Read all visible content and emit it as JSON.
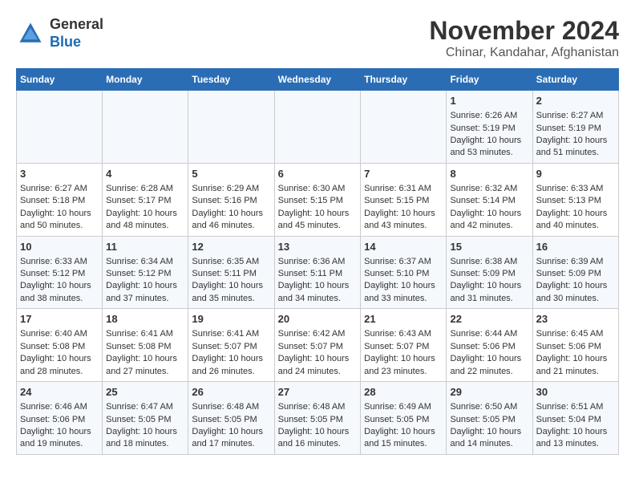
{
  "logo": {
    "line1": "General",
    "line2": "Blue"
  },
  "title": "November 2024",
  "subtitle": "Chinar, Kandahar, Afghanistan",
  "days_of_week": [
    "Sunday",
    "Monday",
    "Tuesday",
    "Wednesday",
    "Thursday",
    "Friday",
    "Saturday"
  ],
  "weeks": [
    [
      {
        "day": "",
        "content": ""
      },
      {
        "day": "",
        "content": ""
      },
      {
        "day": "",
        "content": ""
      },
      {
        "day": "",
        "content": ""
      },
      {
        "day": "",
        "content": ""
      },
      {
        "day": "1",
        "content": "Sunrise: 6:26 AM\nSunset: 5:19 PM\nDaylight: 10 hours and 53 minutes."
      },
      {
        "day": "2",
        "content": "Sunrise: 6:27 AM\nSunset: 5:19 PM\nDaylight: 10 hours and 51 minutes."
      }
    ],
    [
      {
        "day": "3",
        "content": "Sunrise: 6:27 AM\nSunset: 5:18 PM\nDaylight: 10 hours and 50 minutes."
      },
      {
        "day": "4",
        "content": "Sunrise: 6:28 AM\nSunset: 5:17 PM\nDaylight: 10 hours and 48 minutes."
      },
      {
        "day": "5",
        "content": "Sunrise: 6:29 AM\nSunset: 5:16 PM\nDaylight: 10 hours and 46 minutes."
      },
      {
        "day": "6",
        "content": "Sunrise: 6:30 AM\nSunset: 5:15 PM\nDaylight: 10 hours and 45 minutes."
      },
      {
        "day": "7",
        "content": "Sunrise: 6:31 AM\nSunset: 5:15 PM\nDaylight: 10 hours and 43 minutes."
      },
      {
        "day": "8",
        "content": "Sunrise: 6:32 AM\nSunset: 5:14 PM\nDaylight: 10 hours and 42 minutes."
      },
      {
        "day": "9",
        "content": "Sunrise: 6:33 AM\nSunset: 5:13 PM\nDaylight: 10 hours and 40 minutes."
      }
    ],
    [
      {
        "day": "10",
        "content": "Sunrise: 6:33 AM\nSunset: 5:12 PM\nDaylight: 10 hours and 38 minutes."
      },
      {
        "day": "11",
        "content": "Sunrise: 6:34 AM\nSunset: 5:12 PM\nDaylight: 10 hours and 37 minutes."
      },
      {
        "day": "12",
        "content": "Sunrise: 6:35 AM\nSunset: 5:11 PM\nDaylight: 10 hours and 35 minutes."
      },
      {
        "day": "13",
        "content": "Sunrise: 6:36 AM\nSunset: 5:11 PM\nDaylight: 10 hours and 34 minutes."
      },
      {
        "day": "14",
        "content": "Sunrise: 6:37 AM\nSunset: 5:10 PM\nDaylight: 10 hours and 33 minutes."
      },
      {
        "day": "15",
        "content": "Sunrise: 6:38 AM\nSunset: 5:09 PM\nDaylight: 10 hours and 31 minutes."
      },
      {
        "day": "16",
        "content": "Sunrise: 6:39 AM\nSunset: 5:09 PM\nDaylight: 10 hours and 30 minutes."
      }
    ],
    [
      {
        "day": "17",
        "content": "Sunrise: 6:40 AM\nSunset: 5:08 PM\nDaylight: 10 hours and 28 minutes."
      },
      {
        "day": "18",
        "content": "Sunrise: 6:41 AM\nSunset: 5:08 PM\nDaylight: 10 hours and 27 minutes."
      },
      {
        "day": "19",
        "content": "Sunrise: 6:41 AM\nSunset: 5:07 PM\nDaylight: 10 hours and 26 minutes."
      },
      {
        "day": "20",
        "content": "Sunrise: 6:42 AM\nSunset: 5:07 PM\nDaylight: 10 hours and 24 minutes."
      },
      {
        "day": "21",
        "content": "Sunrise: 6:43 AM\nSunset: 5:07 PM\nDaylight: 10 hours and 23 minutes."
      },
      {
        "day": "22",
        "content": "Sunrise: 6:44 AM\nSunset: 5:06 PM\nDaylight: 10 hours and 22 minutes."
      },
      {
        "day": "23",
        "content": "Sunrise: 6:45 AM\nSunset: 5:06 PM\nDaylight: 10 hours and 21 minutes."
      }
    ],
    [
      {
        "day": "24",
        "content": "Sunrise: 6:46 AM\nSunset: 5:06 PM\nDaylight: 10 hours and 19 minutes."
      },
      {
        "day": "25",
        "content": "Sunrise: 6:47 AM\nSunset: 5:05 PM\nDaylight: 10 hours and 18 minutes."
      },
      {
        "day": "26",
        "content": "Sunrise: 6:48 AM\nSunset: 5:05 PM\nDaylight: 10 hours and 17 minutes."
      },
      {
        "day": "27",
        "content": "Sunrise: 6:48 AM\nSunset: 5:05 PM\nDaylight: 10 hours and 16 minutes."
      },
      {
        "day": "28",
        "content": "Sunrise: 6:49 AM\nSunset: 5:05 PM\nDaylight: 10 hours and 15 minutes."
      },
      {
        "day": "29",
        "content": "Sunrise: 6:50 AM\nSunset: 5:05 PM\nDaylight: 10 hours and 14 minutes."
      },
      {
        "day": "30",
        "content": "Sunrise: 6:51 AM\nSunset: 5:04 PM\nDaylight: 10 hours and 13 minutes."
      }
    ]
  ]
}
